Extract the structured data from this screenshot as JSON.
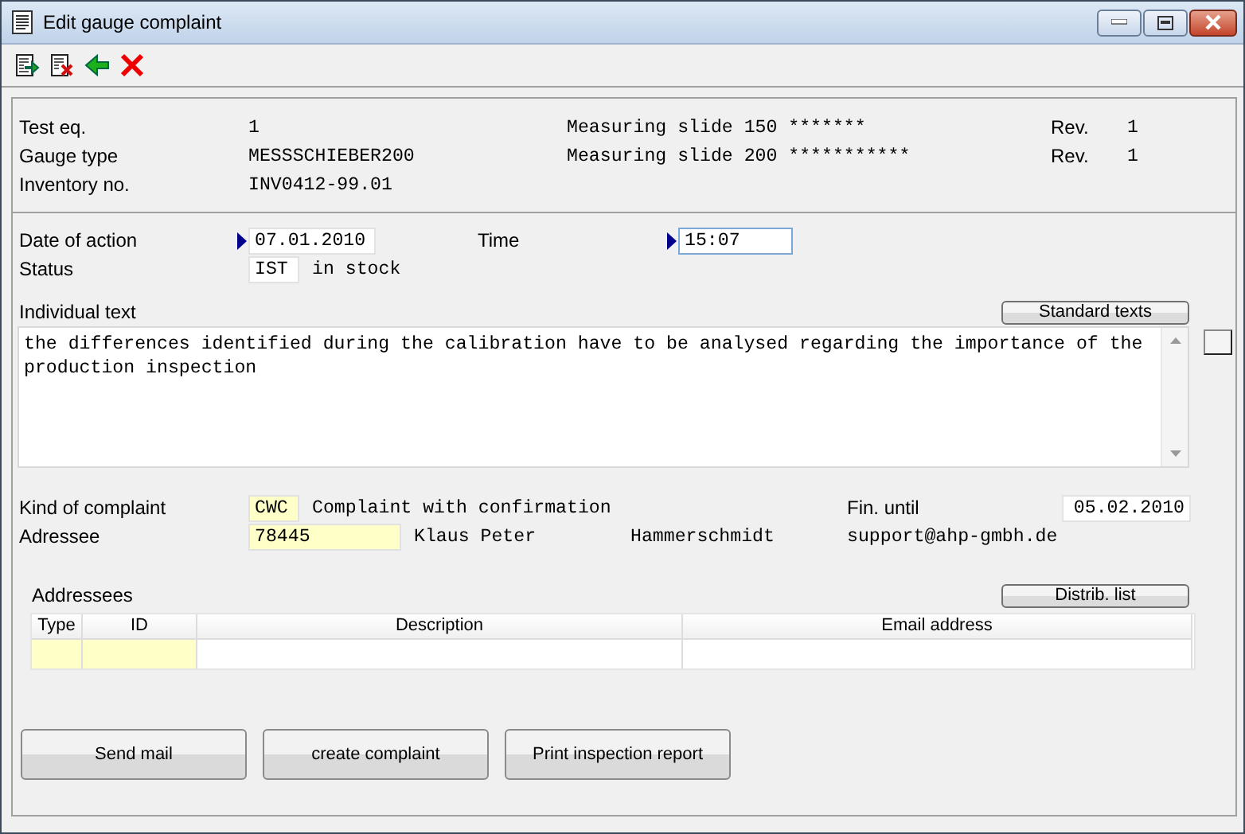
{
  "window": {
    "title": "Edit gauge complaint"
  },
  "header": [
    {
      "label": "Test eq.",
      "value": "1",
      "description": "Measuring slide 150 *******",
      "rev_label": "Rev.",
      "rev": "1"
    },
    {
      "label": "Gauge type",
      "value": "MESSSCHIEBER200",
      "description": "Measuring slide 200 ***********",
      "rev_label": "Rev.",
      "rev": "1"
    },
    {
      "label": "Inventory no.",
      "value": "INV0412-99.01"
    }
  ],
  "action": {
    "date_label": "Date of action",
    "date": {
      "value": "07.01.2010",
      "required": false
    },
    "time_label": "Time",
    "time": {
      "value": "15:07",
      "required": false,
      "focused": true
    },
    "status_label": "Status",
    "status": {
      "value": "IST",
      "required": false
    },
    "status_text": "in stock"
  },
  "individual_text": {
    "label": "Individual text",
    "button": "Standard texts",
    "value": "the differences identified during the calibration have to be analysed regarding the importance of the production inspection"
  },
  "complaint": {
    "kind_label": "Kind of complaint",
    "kind": {
      "value": "CWC",
      "required": true
    },
    "kind_text": "Complaint with confirmation",
    "fin_label": "Fin. until",
    "fin": {
      "value": "05.02.2010",
      "required": false
    },
    "addressee_label": "Adressee",
    "addressee": {
      "value": "78445",
      "required": true
    },
    "first_name": "Klaus Peter",
    "last_name": "Hammerschmidt",
    "email": "support@ahp-gmbh.de"
  },
  "addressees": {
    "label": "Addressees",
    "button": "Distrib. list",
    "columns": [
      {
        "label": "Type",
        "required": true
      },
      {
        "label": "ID",
        "required": true
      },
      {
        "label": "Description",
        "required": false
      },
      {
        "label": "Email address",
        "required": false
      }
    ]
  },
  "buttons": [
    "Send mail",
    "create complaint",
    "Print inspection report"
  ]
}
